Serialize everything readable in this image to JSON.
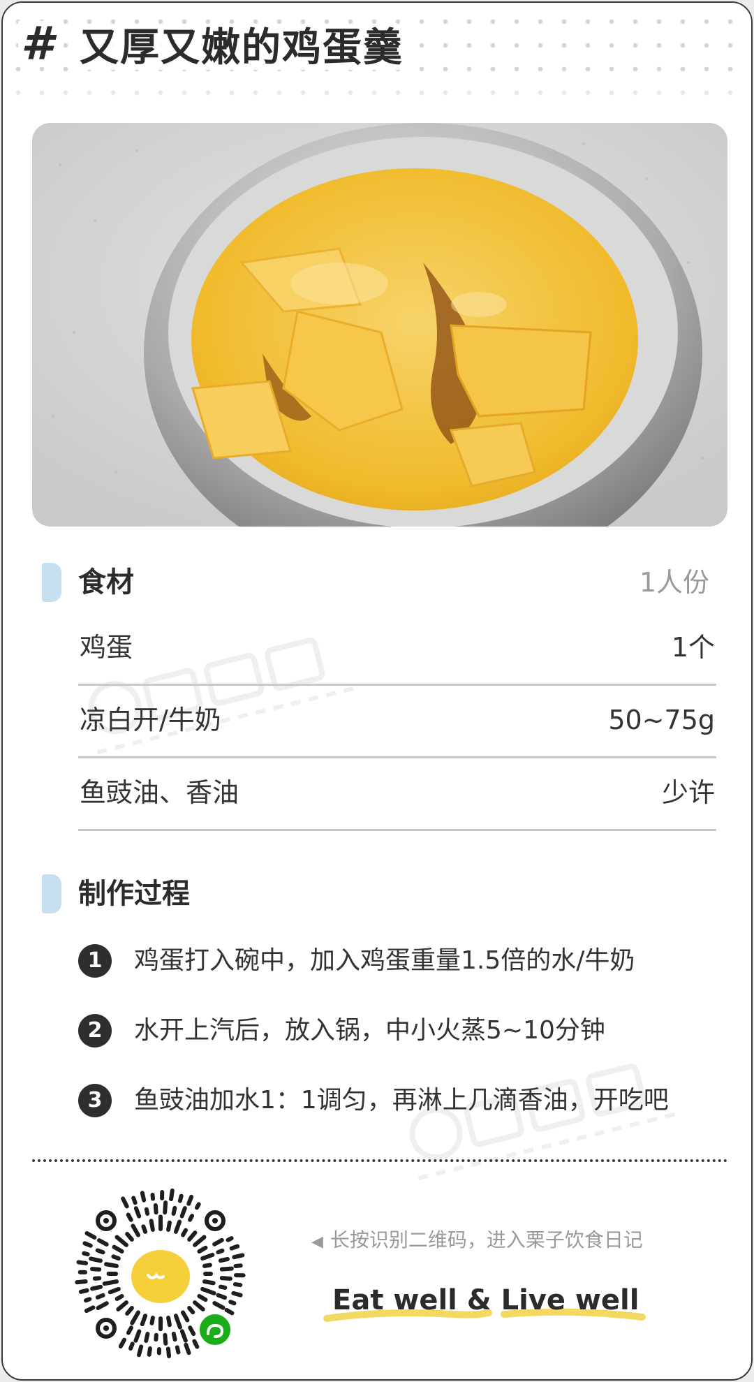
{
  "title": {
    "hash": "#",
    "text": "又厚又嫩的鸡蛋羹"
  },
  "photo": {
    "icon": "steamed-egg-custard-photo"
  },
  "ingredients": {
    "section_title": "食材",
    "servings": "1人份",
    "items": [
      {
        "name": "鸡蛋",
        "amount": "1个"
      },
      {
        "name": "凉白开/牛奶",
        "amount": "50~75g"
      },
      {
        "name": "鱼豉油、香油",
        "amount": "少许"
      }
    ]
  },
  "steps": {
    "section_title": "制作过程",
    "items": [
      {
        "num": "1",
        "text": "鸡蛋打入碗中，加入鸡蛋重量1.5倍的水/牛奶"
      },
      {
        "num": "2",
        "text": "水开上汽后，放入锅，中小火蒸5~10分钟"
      },
      {
        "num": "3",
        "text": "鱼豉油加水1：1调匀，再淋上几滴香油，开吃吧"
      }
    ]
  },
  "footer": {
    "qr_icon": "mini-program-qr-code",
    "hint": "长按识别二维码，进入栗子饮食日记",
    "slogan": "Eat well  &  Live well"
  },
  "colors": {
    "accent": "#c6e0ef",
    "text": "#2b2b2b",
    "muted": "#9a9a9a",
    "highlight": "#f4d860",
    "mini_program_green": "#1aad19"
  }
}
